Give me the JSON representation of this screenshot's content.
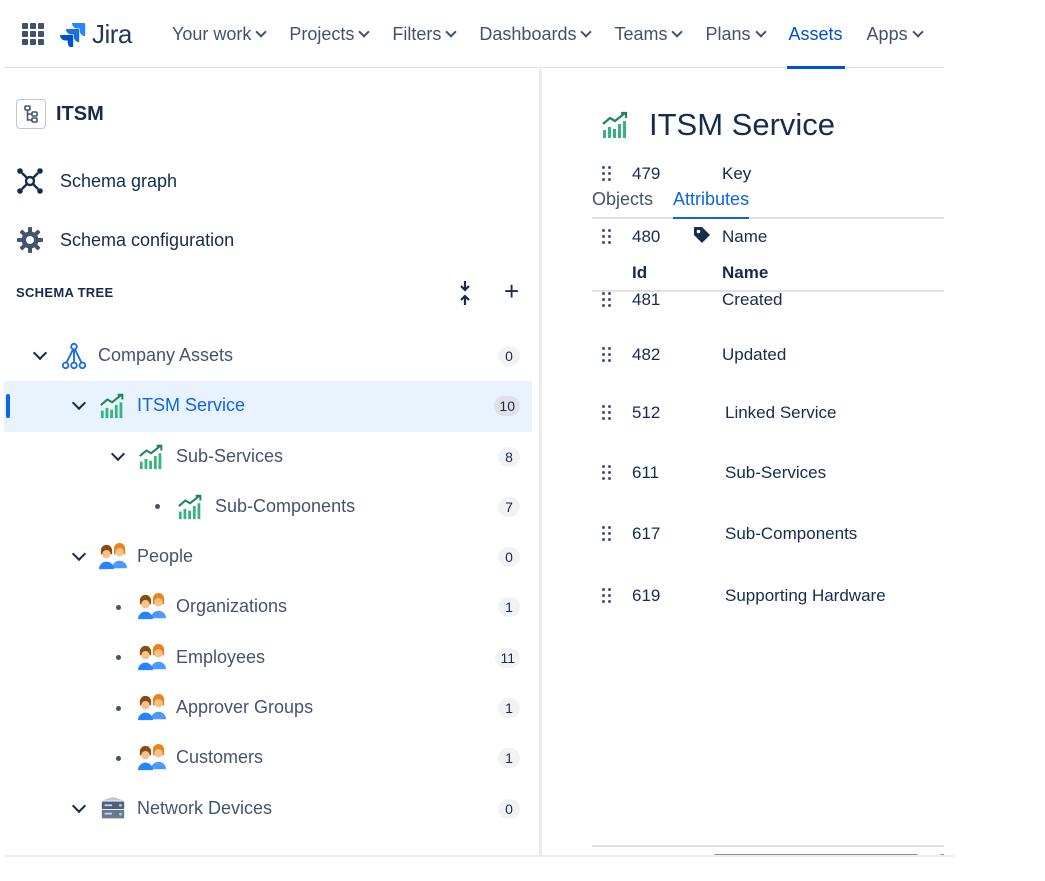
{
  "nav": {
    "logo_text": "Jira",
    "items": [
      {
        "label": "Your work",
        "dropdown": true
      },
      {
        "label": "Projects",
        "dropdown": true
      },
      {
        "label": "Filters",
        "dropdown": true
      },
      {
        "label": "Dashboards",
        "dropdown": true
      },
      {
        "label": "Teams",
        "dropdown": true
      },
      {
        "label": "Plans",
        "dropdown": true
      },
      {
        "label": "Assets",
        "dropdown": false,
        "active": true
      },
      {
        "label": "Apps",
        "dropdown": true
      }
    ]
  },
  "sidebar": {
    "schema_title": "ITSM",
    "links": [
      {
        "label": "Schema graph",
        "icon": "schema-graph-icon"
      },
      {
        "label": "Schema configuration",
        "icon": "gear-icon"
      }
    ],
    "tree_header": "SCHEMA TREE",
    "tree": [
      {
        "label": "Company Assets",
        "count": "0",
        "level": 0,
        "toggle": "caret",
        "icon": "hierarchy-icon"
      },
      {
        "label": "ITSM Service",
        "count": "10",
        "level": 1,
        "toggle": "caret",
        "icon": "chart-icon",
        "selected": true
      },
      {
        "label": "Sub-Services",
        "count": "8",
        "level": 2,
        "toggle": "caret",
        "icon": "chart-icon"
      },
      {
        "label": "Sub-Components",
        "count": "7",
        "level": 3,
        "toggle": "bullet",
        "icon": "chart-icon"
      },
      {
        "label": "People",
        "count": "0",
        "level": 1,
        "toggle": "caret",
        "icon": "people-icon"
      },
      {
        "label": "Organizations",
        "count": "1",
        "level": 2,
        "toggle": "bullet",
        "icon": "people-icon"
      },
      {
        "label": "Employees",
        "count": "11",
        "level": 2,
        "toggle": "bullet",
        "icon": "people-icon"
      },
      {
        "label": "Approver Groups",
        "count": "1",
        "level": 2,
        "toggle": "bullet",
        "icon": "people-icon"
      },
      {
        "label": "Customers",
        "count": "1",
        "level": 2,
        "toggle": "bullet",
        "icon": "people-icon"
      },
      {
        "label": "Network Devices",
        "count": "0",
        "level": 1,
        "toggle": "caret",
        "icon": "server-icon"
      }
    ]
  },
  "main": {
    "title": "ITSM Service",
    "tabs": [
      {
        "label": "Objects",
        "active": false
      },
      {
        "label": "Attributes",
        "active": true
      }
    ],
    "columns": {
      "id": "Id",
      "name": "Name"
    },
    "attributes": [
      {
        "id": "479",
        "name": "Key",
        "tag": false
      },
      {
        "id": "480",
        "name": "Name",
        "tag": true
      },
      {
        "id": "481",
        "name": "Created",
        "tag": false
      },
      {
        "id": "482",
        "name": "Updated",
        "tag": false
      },
      {
        "id": "512",
        "name": "Linked Service",
        "tag": false
      },
      {
        "id": "611",
        "name": "Sub-Services",
        "tag": false
      },
      {
        "id": "617",
        "name": "Sub-Components",
        "tag": false
      },
      {
        "id": "619",
        "name": "Supporting Hardware",
        "tag": false
      }
    ]
  },
  "colors": {
    "accent": "#0c66e4",
    "nav_active": "#0052cc",
    "selected_bg": "#e9f2ff",
    "chart_green": "#36b37e"
  }
}
